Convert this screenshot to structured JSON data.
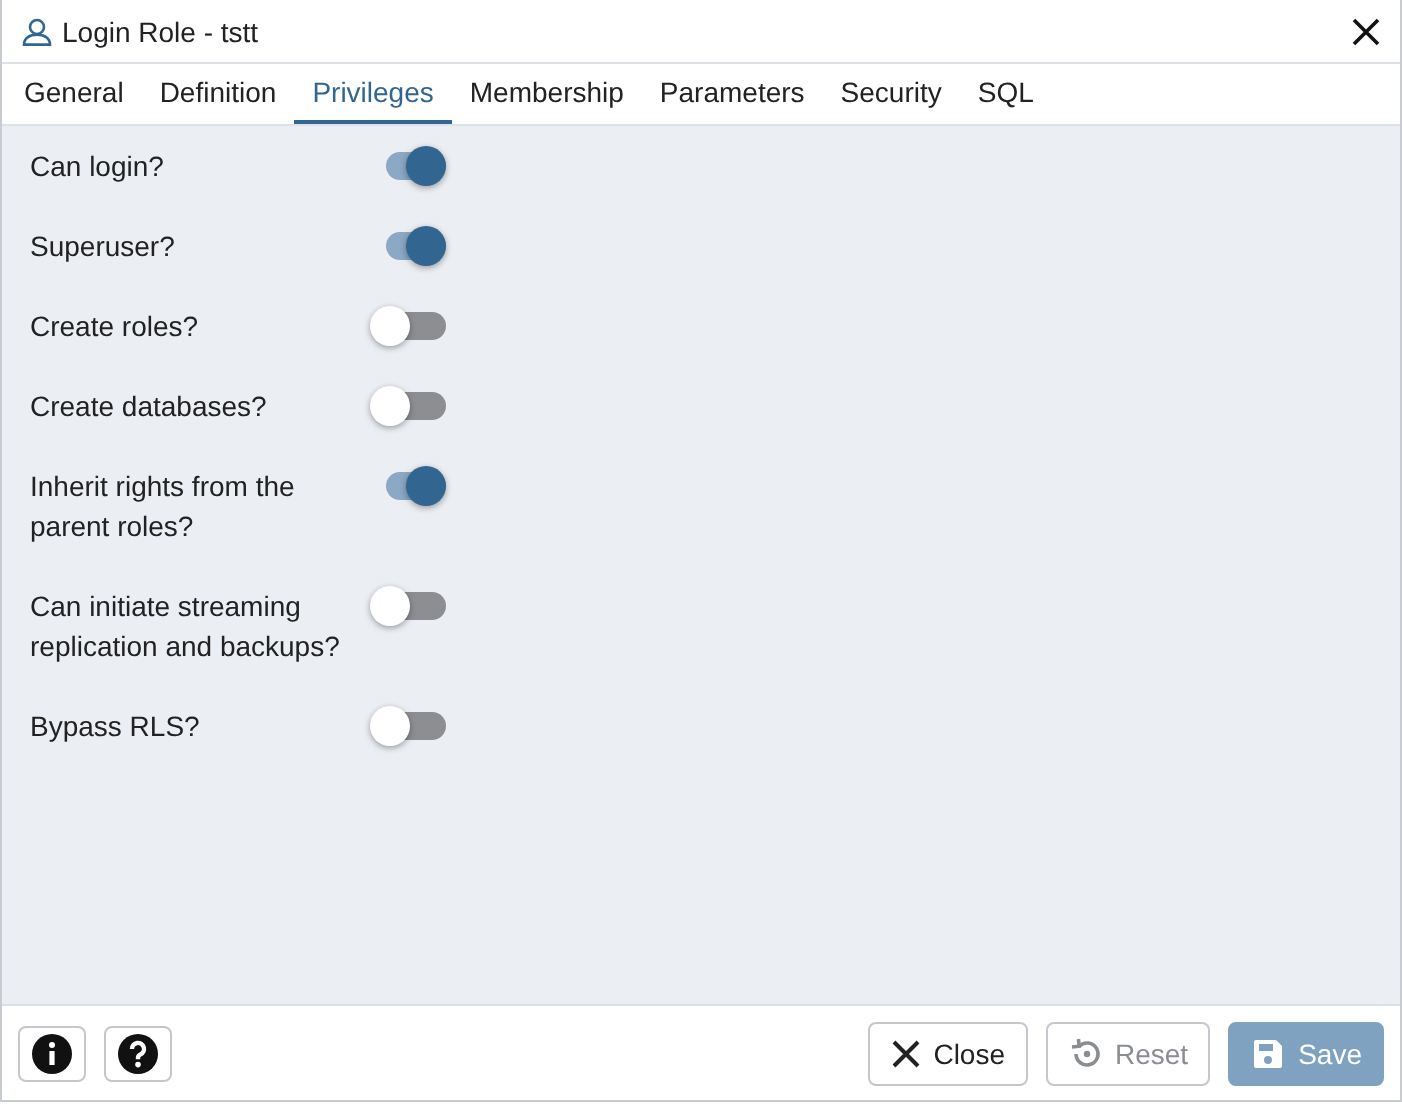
{
  "window": {
    "title": "Login Role - tstt"
  },
  "tabs": [
    {
      "label": "General",
      "selected": false
    },
    {
      "label": "Definition",
      "selected": false
    },
    {
      "label": "Privileges",
      "selected": true
    },
    {
      "label": "Membership",
      "selected": false
    },
    {
      "label": "Parameters",
      "selected": false
    },
    {
      "label": "Security",
      "selected": false
    },
    {
      "label": "SQL",
      "selected": false
    }
  ],
  "privileges": [
    {
      "label": "Can login?",
      "on": true
    },
    {
      "label": "Superuser?",
      "on": true
    },
    {
      "label": "Create roles?",
      "on": false
    },
    {
      "label": "Create databases?",
      "on": false
    },
    {
      "label": "Inherit rights from the parent roles?",
      "on": true
    },
    {
      "label": "Can initiate streaming replication and backups?",
      "on": false
    },
    {
      "label": "Bypass RLS?",
      "on": false
    }
  ],
  "footer": {
    "help_buttons": [
      {
        "kind": "info"
      },
      {
        "kind": "help"
      }
    ],
    "buttons": [
      {
        "kind": "close",
        "label": "Close",
        "disabled": false
      },
      {
        "kind": "reset",
        "label": "Reset",
        "disabled": true
      },
      {
        "kind": "save",
        "label": "Save",
        "disabled": true
      }
    ]
  }
}
